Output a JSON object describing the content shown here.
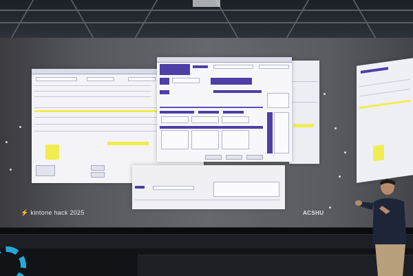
{
  "scene": {
    "description_tags": [
      "stage",
      "projection-screen",
      "presenter",
      "kintone-ui"
    ]
  },
  "branding": {
    "event_logo_text": "kintone hack 2025",
    "presenter_brand": "ACSHU"
  },
  "colors": {
    "accent_purple": "#4d3fa7",
    "highlight_yellow": "#f1ec52",
    "logo_blue": "#27a7d8",
    "bolt_yellow": "#f6c64d"
  },
  "icons": {
    "logo": "bolt-icon",
    "stage_logo": "gear-icon"
  }
}
